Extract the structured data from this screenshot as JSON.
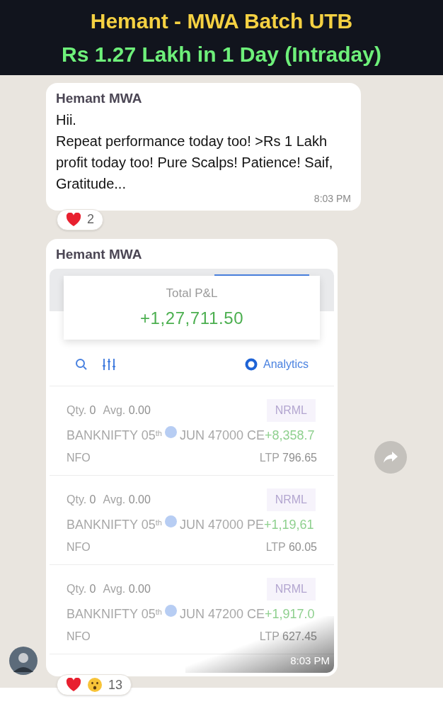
{
  "banner": {
    "title": "Hemant - MWA Batch UTB",
    "subtitle": "Rs 1.27 Lakh in 1 Day (Intraday)"
  },
  "messages": [
    {
      "kind": "text",
      "sender": "Hemant MWA",
      "lines": [
        "Hii.",
        "Repeat performance today too! >Rs 1 Lakh profit today too! Pure Scalps! Patience! Saif, Gratitude..."
      ],
      "time": "8:03 PM",
      "reaction_count": "2"
    },
    {
      "kind": "image",
      "sender": "Hemant MWA",
      "time": "8:03 PM",
      "reaction_count": "13",
      "screenshot": {
        "total_label": "Total P&L",
        "total_value": "+1,27,711.50",
        "analytics": "Analytics",
        "positions": [
          {
            "qty_label": "Qty.",
            "qty": "0",
            "avg_label": "Avg.",
            "avg": "0.00",
            "product": "NRML",
            "symbol": "BANKNIFTY 05",
            "suffix": "th",
            "contract": "JUN 47000 CE",
            "pnl": "+8,358.7",
            "exchange": "NFO",
            "ltp_label": "LTP",
            "ltp": "796.65"
          },
          {
            "qty_label": "Qty.",
            "qty": "0",
            "avg_label": "Avg.",
            "avg": "0.00",
            "product": "NRML",
            "symbol": "BANKNIFTY 05",
            "suffix": "th",
            "contract": "JUN 47000 PE",
            "pnl": "+1,19,61",
            "exchange": "NFO",
            "ltp_label": "LTP",
            "ltp": "60.05"
          },
          {
            "qty_label": "Qty.",
            "qty": "0",
            "avg_label": "Avg.",
            "avg": "0.00",
            "product": "NRML",
            "symbol": "BANKNIFTY 05",
            "suffix": "th",
            "contract": "JUN 47200 CE",
            "pnl": "+1,917.0",
            "exchange": "NFO",
            "ltp_label": "LTP",
            "ltp": "627.45"
          }
        ]
      }
    }
  ]
}
